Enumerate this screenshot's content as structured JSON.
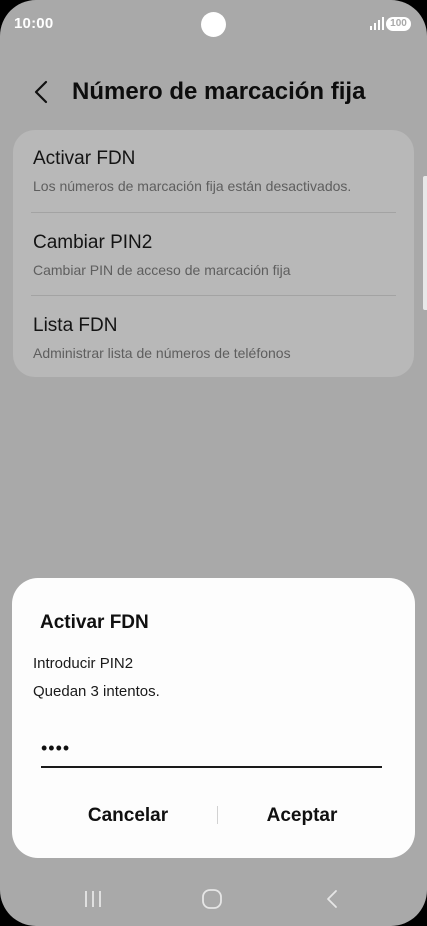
{
  "status_bar": {
    "time": "10:00",
    "battery": "100"
  },
  "header": {
    "title": "Número de marcación fija",
    "back_icon": "chevron-left-icon"
  },
  "settings": {
    "items": [
      {
        "title": "Activar FDN",
        "subtitle": "Los números de marcación fija están desactivados."
      },
      {
        "title": "Cambiar PIN2",
        "subtitle": "Cambiar PIN de acceso de marcación fija"
      },
      {
        "title": "Lista FDN",
        "subtitle": "Administrar lista de números de teléfonos"
      }
    ]
  },
  "dialog": {
    "title": "Activar FDN",
    "message_line1": "Introducir PIN2",
    "message_line2": "Quedan 3 intentos.",
    "pin_value": "1234",
    "cancel_label": "Cancelar",
    "accept_label": "Aceptar"
  },
  "nav_bar": {
    "recents_icon": "recents-icon",
    "home_icon": "home-icon",
    "back_icon": "back-icon"
  },
  "colors": {
    "dim_background": "#a9a9a9",
    "card_background": "#b8b8b8",
    "dialog_background": "#fdfdfd",
    "text_primary": "#101010"
  }
}
